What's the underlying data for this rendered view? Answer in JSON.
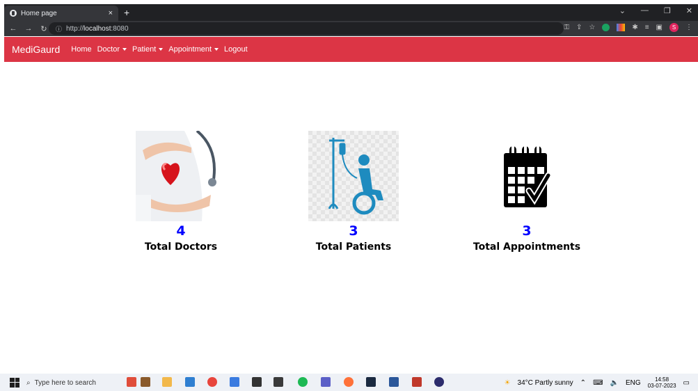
{
  "browser": {
    "tab_title": "Home page",
    "tab_close": "×",
    "new_tab": "+",
    "url_prefix": "http://",
    "url_host": "localhost",
    "url_port": ":8080",
    "avatar_letter": "S"
  },
  "navbar": {
    "brand": "MediGaurd",
    "items": [
      "Home",
      "Doctor",
      "Patient",
      "Appointment",
      "Logout"
    ],
    "color": "#dc3545"
  },
  "stats": [
    {
      "count": "4",
      "label": "Total Doctors",
      "icon": "doctor-heart-image"
    },
    {
      "count": "3",
      "label": "Total Patients",
      "icon": "wheelchair-iv-icon"
    },
    {
      "count": "3",
      "label": "Total Appointments",
      "icon": "calendar-check-icon"
    }
  ],
  "taskbar": {
    "search_placeholder": "Type here to search",
    "weather": "34°C  Partly sunny",
    "lang": "ENG",
    "time": "14:58",
    "date": "03-07-2023"
  }
}
